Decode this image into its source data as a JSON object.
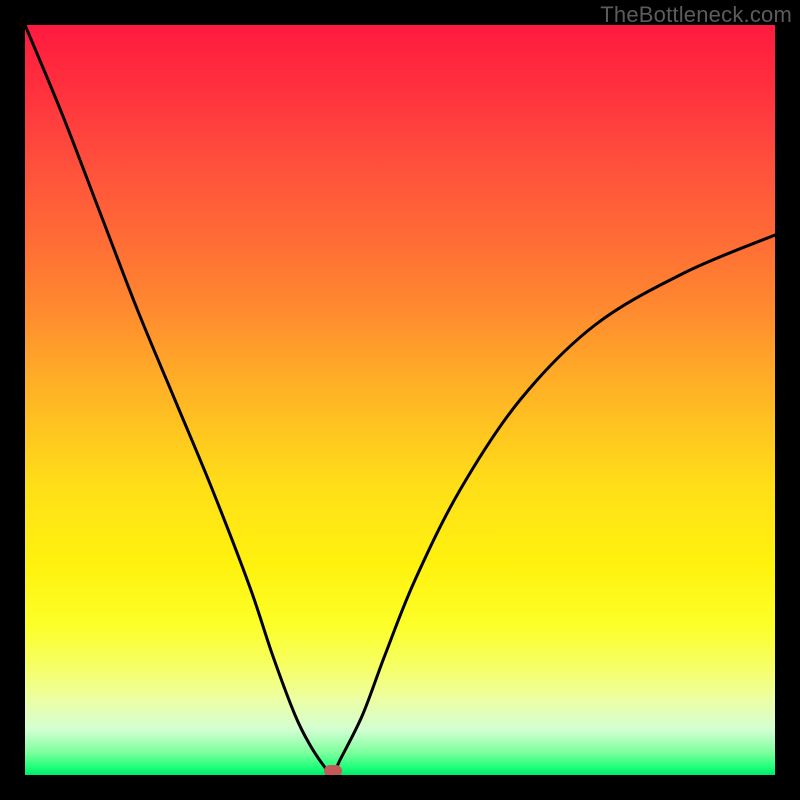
{
  "watermark": "TheBottleneck.com",
  "chart_data": {
    "type": "line",
    "title": "",
    "xlabel": "",
    "ylabel": "",
    "xlim": [
      0,
      100
    ],
    "ylim": [
      0,
      100
    ],
    "grid": false,
    "legend": false,
    "background_gradient": {
      "direction": "vertical",
      "stops": [
        {
          "pct": 0,
          "color": "#ff1a3f"
        },
        {
          "pct": 28,
          "color": "#ff6a36"
        },
        {
          "pct": 54,
          "color": "#ffc520"
        },
        {
          "pct": 80,
          "color": "#fcff28"
        },
        {
          "pct": 94,
          "color": "#d2ffd2"
        },
        {
          "pct": 100,
          "color": "#00e86b"
        }
      ]
    },
    "series": [
      {
        "name": "bottleneck-curve",
        "color": "#000000",
        "x": [
          0,
          5,
          10,
          15,
          20,
          25,
          30,
          33,
          36,
          38,
          40,
          41,
          42,
          45,
          48,
          52,
          58,
          66,
          76,
          88,
          100
        ],
        "y": [
          100,
          88,
          75,
          62,
          50,
          38,
          25,
          16,
          8,
          4,
          1,
          0,
          2,
          8,
          16,
          26,
          38,
          50,
          60,
          67,
          72
        ]
      }
    ],
    "marker": {
      "x": 41,
      "y": 0.5,
      "color": "#c45a57"
    }
  }
}
